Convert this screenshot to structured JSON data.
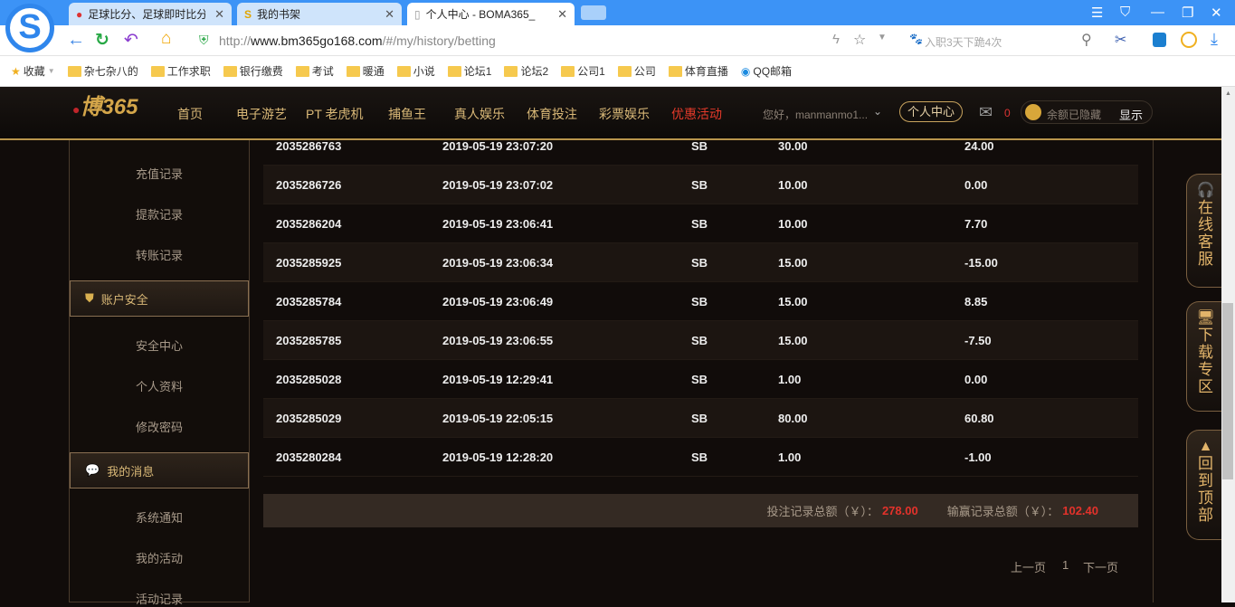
{
  "browser": {
    "tabs": [
      {
        "title": "足球比分、足球即时比分"
      },
      {
        "title": "我的书架"
      },
      {
        "title": "个人中心 - BOMA365_"
      }
    ],
    "url_prefix": "http://",
    "url_host": "www.bm365go168.com",
    "url_path": "/#/my/history/betting",
    "search_placeholder": "入职3天下跪4次",
    "bookmarks": [
      "收藏",
      "杂七杂八的",
      "工作求职",
      "银行缴费",
      "考试",
      "暖通",
      "小说",
      "论坛1",
      "论坛2",
      "公司1",
      "公司",
      "体育直播",
      "QQ邮箱"
    ]
  },
  "site": {
    "logo": "博365",
    "nav": [
      "首页",
      "电子游艺",
      "PT 老虎机",
      "捕鱼王",
      "真人娱乐",
      "体育投注",
      "彩票娱乐",
      "优惠活动"
    ],
    "greeting": "您好，manmanmo1...",
    "personal_center": "个人中心",
    "mail_count": "0",
    "balance_hidden": "余额已隐藏",
    "show": "显示"
  },
  "sidebar": {
    "items_top": [
      "充值记录",
      "提款记录",
      "转账记录"
    ],
    "section_security": "账户安全",
    "items_security": [
      "安全中心",
      "个人资料",
      "修改密码"
    ],
    "section_messages": "我的消息",
    "items_messages": [
      "系统通知",
      "我的活动",
      "活动记录"
    ]
  },
  "rows": [
    [
      "2035286763",
      "2019-05-19 23:07:20",
      "SB",
      "30.00",
      "24.00"
    ],
    [
      "2035286726",
      "2019-05-19 23:07:02",
      "SB",
      "10.00",
      "0.00"
    ],
    [
      "2035286204",
      "2019-05-19 23:06:41",
      "SB",
      "10.00",
      "7.70"
    ],
    [
      "2035285925",
      "2019-05-19 23:06:34",
      "SB",
      "15.00",
      "-15.00"
    ],
    [
      "2035285784",
      "2019-05-19 23:06:49",
      "SB",
      "15.00",
      "8.85"
    ],
    [
      "2035285785",
      "2019-05-19 23:06:55",
      "SB",
      "15.00",
      "-7.50"
    ],
    [
      "2035285028",
      "2019-05-19 12:29:41",
      "SB",
      "1.00",
      "0.00"
    ],
    [
      "2035285029",
      "2019-05-19 22:05:15",
      "SB",
      "80.00",
      "60.80"
    ],
    [
      "2035280284",
      "2019-05-19 12:28:20",
      "SB",
      "1.00",
      "-1.00"
    ]
  ],
  "summary": {
    "bet_label": "投注记录总额（￥）：",
    "bet_total": "278.00",
    "win_label": "输赢记录总额（￥）：",
    "win_total": "102.40"
  },
  "pagination": {
    "prev": "上一页",
    "page": "1",
    "next": "下一页"
  },
  "float": {
    "service": "在线客服",
    "download": "下载专区",
    "top": "回到顶部"
  }
}
